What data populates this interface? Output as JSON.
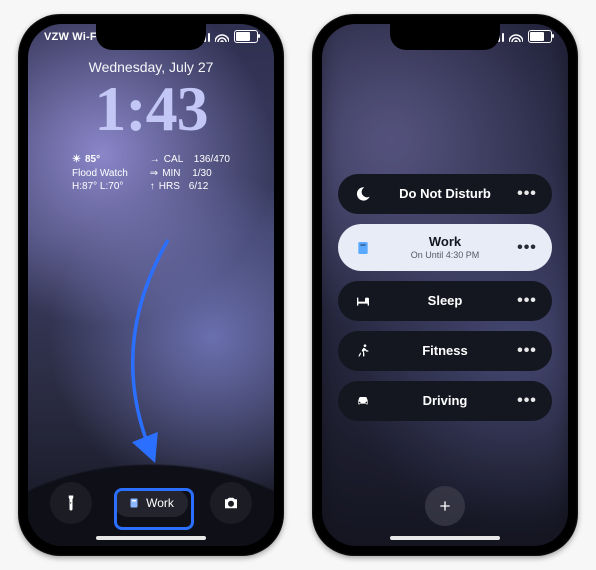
{
  "left": {
    "carrier": "VZW Wi-Fi",
    "date": "Wednesday, July 27",
    "time": "1:43",
    "weather": {
      "icon": "☀︎",
      "temp": "85°",
      "alert": "Flood Watch",
      "hiLo": "H:87° L:70°"
    },
    "schedule": [
      {
        "arrow": "→",
        "label": "CAL",
        "value": "136/470"
      },
      {
        "arrow": "⇒",
        "label": "MIN",
        "value": "1/30"
      },
      {
        "arrow": "↑",
        "label": "HRS",
        "value": "6/12"
      }
    ],
    "focusPill": {
      "label": "Work"
    }
  },
  "right": {
    "focusModes": [
      {
        "id": "dnd",
        "title": "Do Not Disturb",
        "sub": "",
        "theme": "dark",
        "icon": "moon"
      },
      {
        "id": "work",
        "title": "Work",
        "sub": "On Until 4:30 PM",
        "theme": "light",
        "icon": "badge"
      },
      {
        "id": "sleep",
        "title": "Sleep",
        "sub": "",
        "theme": "dark",
        "icon": "bed"
      },
      {
        "id": "fitness",
        "title": "Fitness",
        "sub": "",
        "theme": "dark",
        "icon": "run"
      },
      {
        "id": "driving",
        "title": "Driving",
        "sub": "",
        "theme": "dark",
        "icon": "car"
      }
    ]
  }
}
